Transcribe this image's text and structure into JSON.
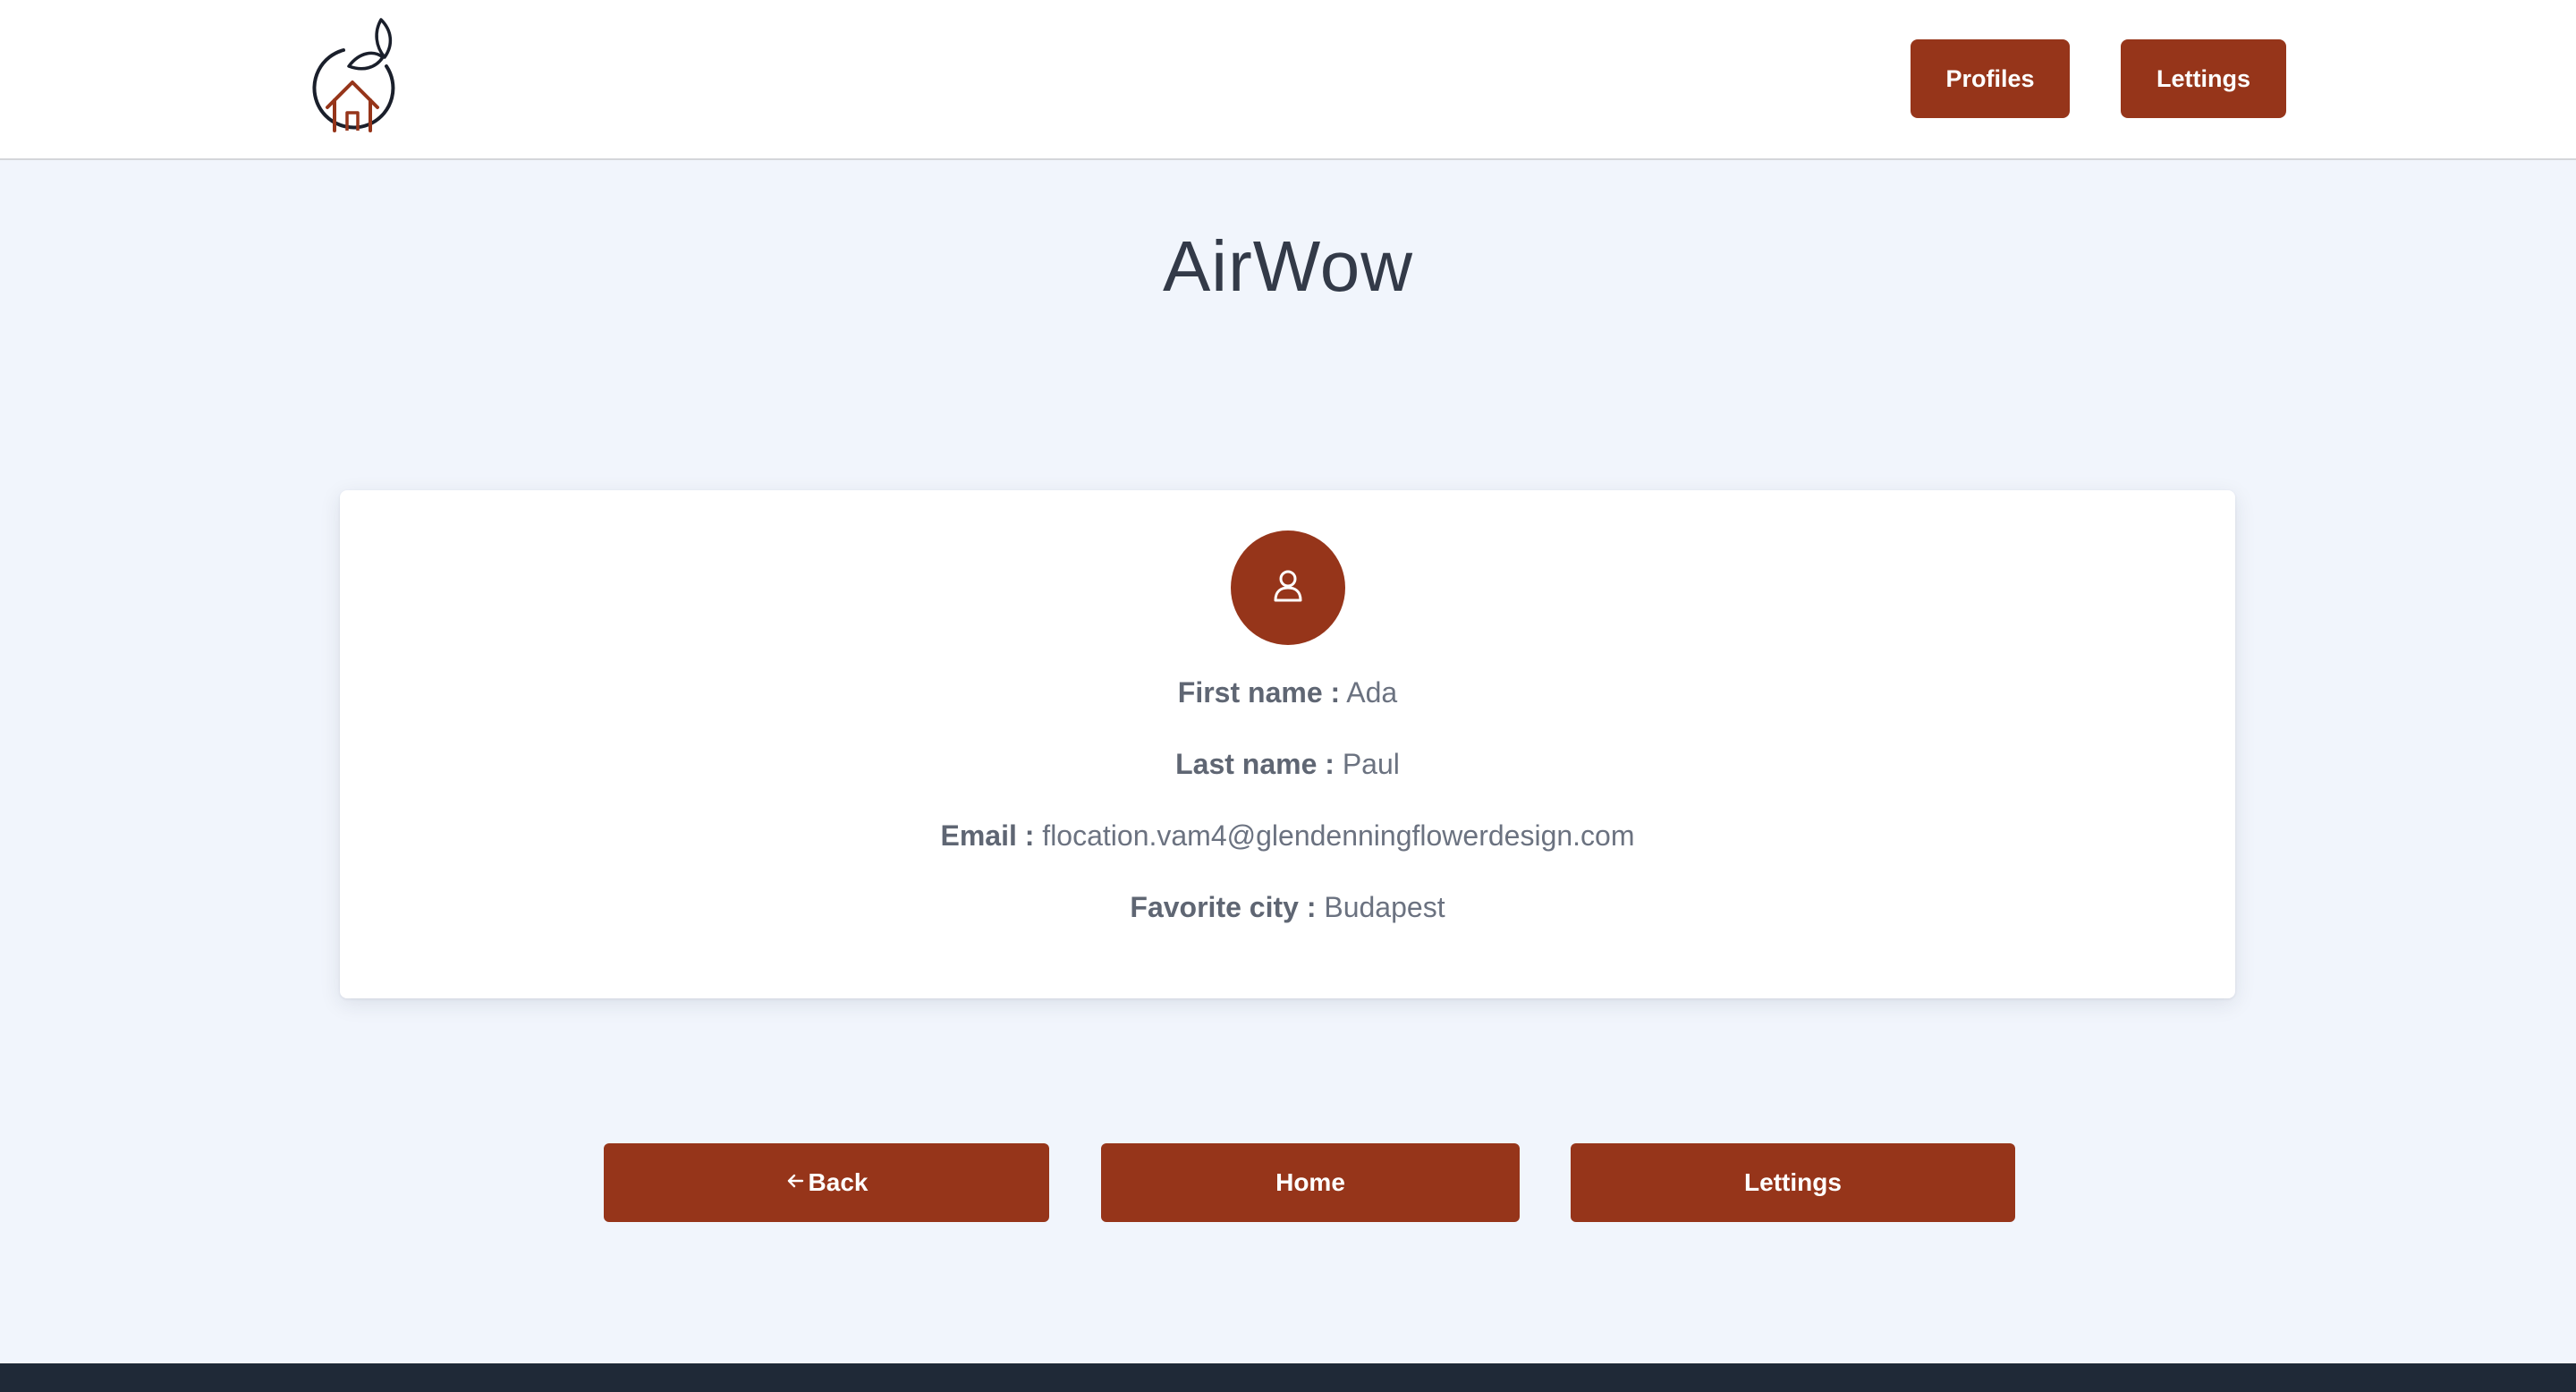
{
  "header": {
    "logo_icon": "house-peach-logo-icon",
    "nav": {
      "profiles_label": "Profiles",
      "lettings_label": "Lettings"
    }
  },
  "page": {
    "title": "AirWow"
  },
  "profile": {
    "avatar_icon": "user-icon",
    "fields": [
      {
        "label": "First name :",
        "value": "Ada"
      },
      {
        "label": "Last name :",
        "value": "Paul"
      },
      {
        "label": "Email :",
        "value": "flocation.vam4@glendenningflowerdesign.com"
      },
      {
        "label": "Favorite city :",
        "value": "Budapest"
      }
    ]
  },
  "actions": {
    "back_label": "Back",
    "back_icon": "arrow-left-icon",
    "home_label": "Home",
    "lettings_label": "Lettings"
  },
  "colors": {
    "accent": "#96351a",
    "page_bg": "#f1f5fc",
    "header_bg": "#ffffff",
    "footer_bg": "#1f2937",
    "title_text": "#333a48",
    "body_text": "#6b7280"
  }
}
